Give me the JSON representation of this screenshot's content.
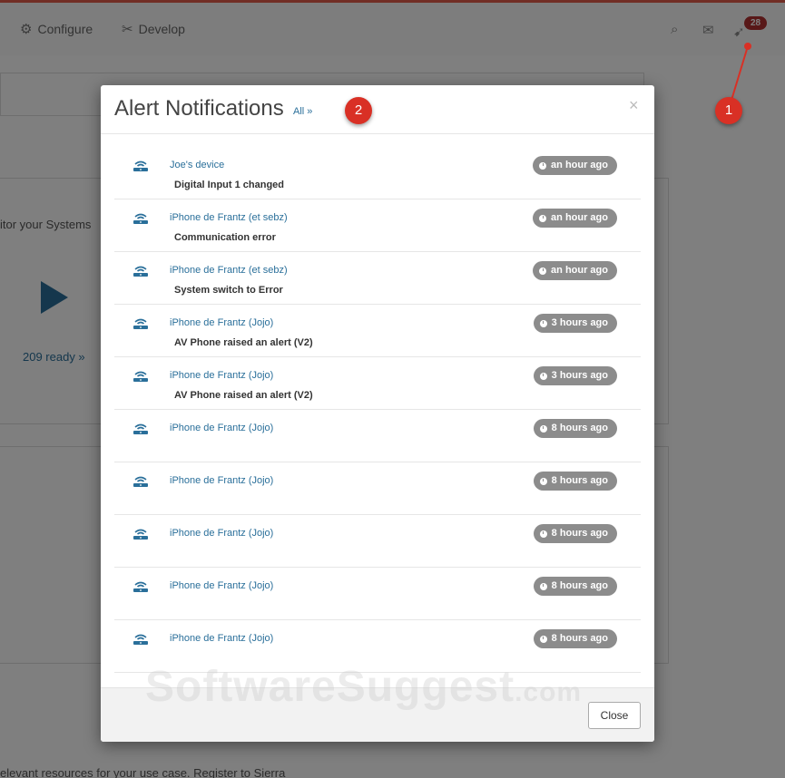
{
  "navbar": {
    "configure_label": "Configure",
    "develop_label": "Develop",
    "notification_count": "28"
  },
  "background": {
    "monitor_text": "itor your Systems",
    "ready_link": "209 ready »",
    "bottom_text": "elevant resources for your use case. Register to Sierra"
  },
  "annotations": {
    "marker_1": "1",
    "marker_2": "2"
  },
  "modal": {
    "title": "Alert Notifications",
    "all_link": "All »",
    "close_x": "×",
    "close_button": "Close",
    "alerts": [
      {
        "device": "Joe's device",
        "message": "Digital Input 1 changed",
        "time": "an hour ago"
      },
      {
        "device": "iPhone de Frantz  (et sebz)",
        "message": "Communication error",
        "time": "an hour ago"
      },
      {
        "device": "iPhone de Frantz  (et sebz)",
        "message": "System switch to Error",
        "time": "an hour ago"
      },
      {
        "device": "iPhone de Frantz  (Jojo)",
        "message": "AV Phone raised an alert (V2)",
        "time": "3 hours ago"
      },
      {
        "device": "iPhone de Frantz  (Jojo)",
        "message": "AV Phone raised an alert (V2)",
        "time": "3 hours ago"
      },
      {
        "device": "iPhone de Frantz  (Jojo)",
        "message": "",
        "time": "8 hours ago"
      },
      {
        "device": "iPhone de Frantz  (Jojo)",
        "message": "",
        "time": "8 hours ago"
      },
      {
        "device": "iPhone de Frantz  (Jojo)",
        "message": "",
        "time": "8 hours ago"
      },
      {
        "device": "iPhone de Frantz  (Jojo)",
        "message": "",
        "time": "8 hours ago"
      },
      {
        "device": "iPhone de Frantz  (Jojo)",
        "message": "",
        "time": "8 hours ago"
      }
    ]
  },
  "watermark": {
    "text": "SoftwareSuggest",
    "suffix": ".com"
  },
  "colors": {
    "accent": "#2a6f9a",
    "marker": "#d93025",
    "badge": "#b03030",
    "time_pill": "#8c8c8c"
  }
}
